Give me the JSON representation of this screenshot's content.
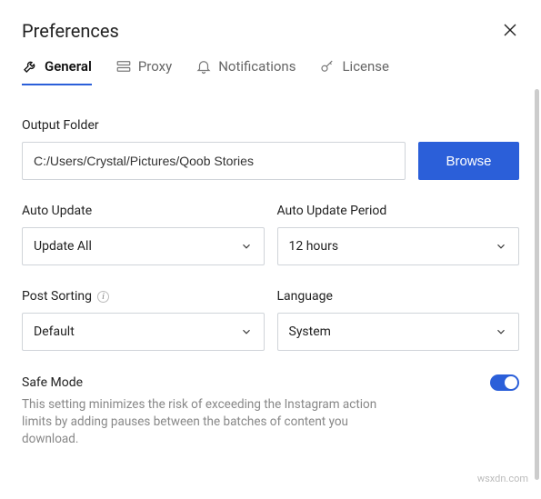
{
  "header": {
    "title": "Preferences"
  },
  "tabs": {
    "general": "General",
    "proxy": "Proxy",
    "notifications": "Notifications",
    "license": "License"
  },
  "output": {
    "label": "Output Folder",
    "value": "C:/Users/Crystal/Pictures/Qoob Stories",
    "browse": "Browse"
  },
  "auto_update": {
    "label": "Auto Update",
    "value": "Update All"
  },
  "auto_update_period": {
    "label": "Auto Update Period",
    "value": "12 hours"
  },
  "post_sorting": {
    "label": "Post Sorting",
    "value": "Default"
  },
  "language": {
    "label": "Language",
    "value": "System"
  },
  "safe_mode": {
    "label": "Safe Mode",
    "description": "This setting minimizes the risk of exceeding the Instagram action limits by adding pauses between the batches of content you download."
  },
  "watermark": "wsxdn.com"
}
